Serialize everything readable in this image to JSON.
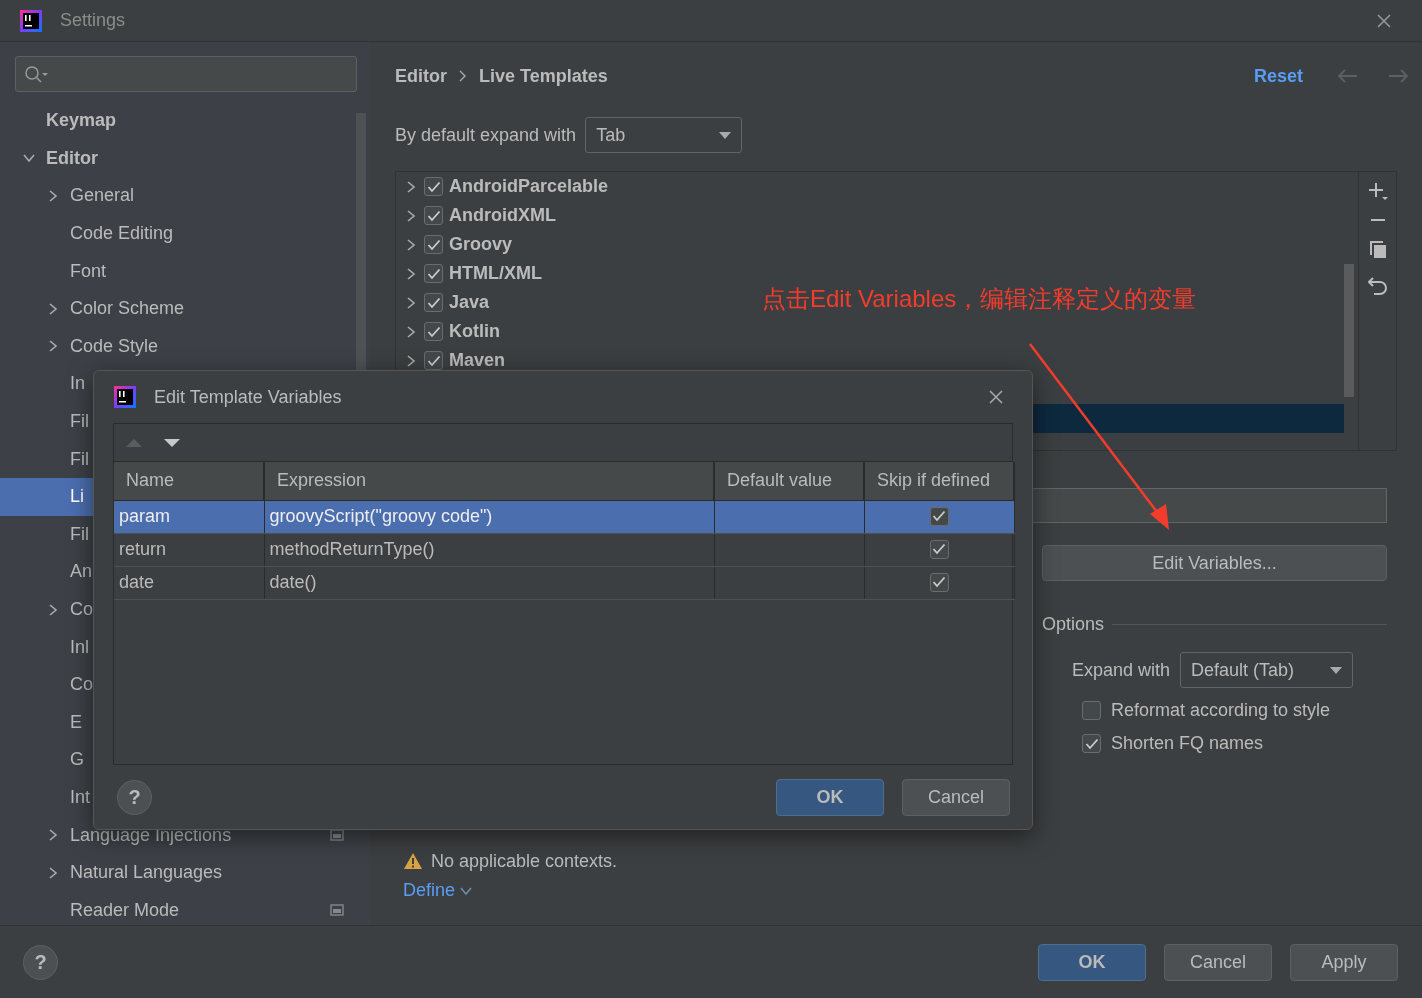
{
  "window": {
    "title": "Settings"
  },
  "sidebar": {
    "items": [
      {
        "label": "Keymap",
        "kind": "page",
        "selected": false,
        "scoped": false
      },
      {
        "label": "Editor",
        "kind": "group",
        "expanded": true,
        "selected": false,
        "scoped": false,
        "children": [
          {
            "label": "General",
            "kind": "group",
            "expanded": false,
            "selected": false,
            "scoped": false
          },
          {
            "label": "Code Editing",
            "kind": "page",
            "selected": false,
            "scoped": false
          },
          {
            "label": "Font",
            "kind": "page",
            "selected": false,
            "scoped": false
          },
          {
            "label": "Color Scheme",
            "kind": "group",
            "expanded": false,
            "selected": false,
            "scoped": false
          },
          {
            "label": "Code Style",
            "kind": "group",
            "expanded": false,
            "selected": false,
            "scoped": false
          },
          {
            "label": "In",
            "kind": "page",
            "selected": false,
            "scoped": false
          },
          {
            "label": "Fil",
            "kind": "page",
            "selected": false,
            "scoped": false
          },
          {
            "label": "Fil",
            "kind": "page",
            "selected": false,
            "scoped": false
          },
          {
            "label": "Li",
            "kind": "page",
            "selected": true,
            "scoped": false
          },
          {
            "label": "Fil",
            "kind": "page",
            "selected": false,
            "scoped": false
          },
          {
            "label": "An",
            "kind": "page",
            "selected": false,
            "scoped": false
          },
          {
            "label": "Co",
            "kind": "group",
            "expanded": false,
            "selected": false,
            "scoped": false
          },
          {
            "label": "Inl",
            "kind": "page",
            "selected": false,
            "scoped": false
          },
          {
            "label": "Co",
            "kind": "page",
            "selected": false,
            "scoped": false
          },
          {
            "label": "E",
            "kind": "page",
            "selected": false,
            "scoped": false
          },
          {
            "label": "G",
            "kind": "page",
            "selected": false,
            "scoped": false
          },
          {
            "label": "Int",
            "kind": "page",
            "selected": false,
            "scoped": false
          },
          {
            "label": "Language Injections",
            "kind": "group",
            "expanded": false,
            "selected": false,
            "scoped": true
          },
          {
            "label": "Natural Languages",
            "kind": "group",
            "expanded": false,
            "selected": false,
            "scoped": false
          },
          {
            "label": "Reader Mode",
            "kind": "page",
            "selected": false,
            "scoped": true
          }
        ]
      }
    ]
  },
  "breadcrumb": [
    "Editor",
    "Live Templates"
  ],
  "reset": "Reset",
  "expand_default": {
    "label": "By default expand with",
    "value": "Tab"
  },
  "template_groups": [
    {
      "label": "AndroidParcelable",
      "checked": true,
      "expanded": false,
      "selected": false
    },
    {
      "label": "AndroidXML",
      "checked": true,
      "expanded": false,
      "selected": false
    },
    {
      "label": "Groovy",
      "checked": true,
      "expanded": false,
      "selected": false
    },
    {
      "label": "HTML/XML",
      "checked": true,
      "expanded": false,
      "selected": false
    },
    {
      "label": "Java",
      "checked": true,
      "expanded": false,
      "selected": false
    },
    {
      "label": "Kotlin",
      "checked": true,
      "expanded": false,
      "selected": false
    },
    {
      "label": "Maven",
      "checked": true,
      "expanded": false,
      "selected": false
    }
  ],
  "covered_rows": [
    {
      "selected": false
    },
    {
      "selected": true
    }
  ],
  "edit_variables_button": "Edit Variables...",
  "options": {
    "title": "Options",
    "expand_with": {
      "label": "Expand with",
      "value": "Default (Tab)"
    },
    "checkboxes": [
      {
        "label": "Reformat according to style",
        "checked": false
      },
      {
        "label": "Shorten FQ names",
        "checked": true
      }
    ]
  },
  "contexts": {
    "warning": "No applicable contexts.",
    "define": "Define"
  },
  "footer": {
    "help": "?",
    "buttons": [
      {
        "label": "OK",
        "kind": "primary"
      },
      {
        "label": "Cancel",
        "kind": "default"
      },
      {
        "label": "Apply",
        "kind": "default"
      }
    ]
  },
  "annotation": {
    "text": "点击Edit Variables，编辑注释定义的变量"
  },
  "dialog": {
    "title": "Edit Template Variables",
    "move_buttons": [
      {
        "kind": "up",
        "disabled": true
      },
      {
        "kind": "down",
        "disabled": false
      }
    ],
    "columns": [
      "Name",
      "Expression",
      "Default value",
      "Skip if defined"
    ],
    "rows": [
      {
        "name": "param",
        "expression": "groovyScript(\"groovy code\")",
        "skip_if_defined": true,
        "selected": true
      },
      {
        "name": "return",
        "expression": "methodReturnType()",
        "skip_if_defined": true,
        "selected": false
      },
      {
        "name": "date",
        "expression": "date()",
        "skip_if_defined": true,
        "selected": false
      }
    ],
    "help": "?",
    "buttons": [
      {
        "label": "OK",
        "kind": "primary"
      },
      {
        "label": "Cancel",
        "kind": "default"
      }
    ]
  }
}
